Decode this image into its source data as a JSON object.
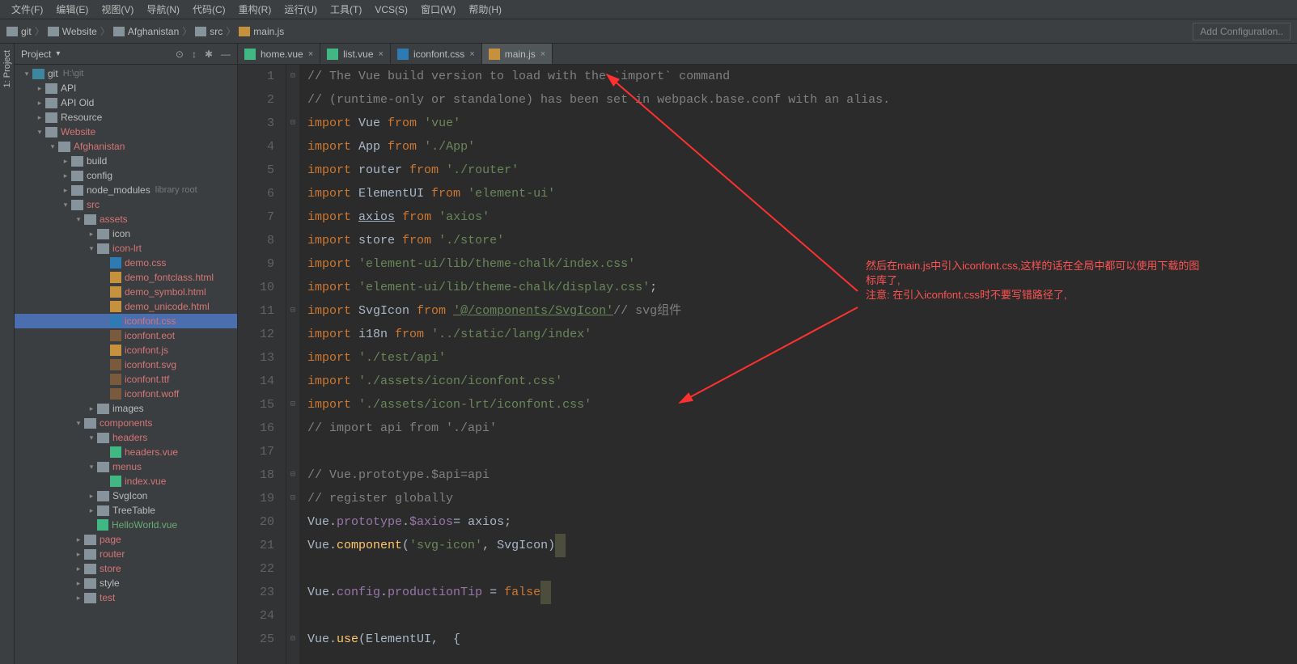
{
  "menu": [
    "文件(F)",
    "编辑(E)",
    "视图(V)",
    "导航(N)",
    "代码(C)",
    "重构(R)",
    "运行(U)",
    "工具(T)",
    "VCS(S)",
    "窗口(W)",
    "帮助(H)"
  ],
  "breadcrumbs": [
    "git",
    "Website",
    "Afghanistan",
    "src",
    "main.js"
  ],
  "configButton": "Add Configuration..",
  "panel": {
    "title": "Project"
  },
  "rootHint": "H:\\git",
  "libHint": "library root",
  "tree": {
    "git": "git",
    "api": "API",
    "apiold": "API Old",
    "resource": "Resource",
    "website": "Website",
    "afghanistan": "Afghanistan",
    "build": "build",
    "config": "config",
    "nodemodules": "node_modules",
    "src": "src",
    "assets": "assets",
    "icon": "icon",
    "iconlrt": "icon-lrt",
    "democss": "demo.css",
    "demofc": "demo_fontclass.html",
    "demosym": "demo_symbol.html",
    "demouni": "demo_unicode.html",
    "iconfontcss": "iconfont.css",
    "iconfonteot": "iconfont.eot",
    "iconfontjs": "iconfont.js",
    "iconfontsvg": "iconfont.svg",
    "iconfontttf": "iconfont.ttf",
    "iconfontwoff": "iconfont.woff",
    "images": "images",
    "components": "components",
    "headers": "headers",
    "headersvue": "headers.vue",
    "menus": "menus",
    "indexvue": "index.vue",
    "svgicon": "SvgIcon",
    "treetable": "TreeTable",
    "helloworld": "HelloWorld.vue",
    "page": "page",
    "router": "router",
    "store": "store",
    "style": "style",
    "test": "test"
  },
  "tabs": [
    {
      "icon": "vue",
      "label": "home.vue"
    },
    {
      "icon": "vue",
      "label": "list.vue"
    },
    {
      "icon": "css",
      "label": "iconfont.css"
    },
    {
      "icon": "js",
      "label": "main.js",
      "active": true
    }
  ],
  "code": [
    {
      "n": 1,
      "t": "comment",
      "text": "// The Vue build version to load with the `import` command"
    },
    {
      "n": 2,
      "t": "comment",
      "text": "// (runtime-only or standalone) has been set in webpack.base.conf with an alias."
    },
    {
      "n": 3,
      "t": "import",
      "ident": "Vue",
      "from": "'vue'"
    },
    {
      "n": 4,
      "t": "import",
      "ident": "App",
      "from": "'./App'"
    },
    {
      "n": 5,
      "t": "import",
      "ident": "router",
      "from": "'./router'"
    },
    {
      "n": 6,
      "t": "import",
      "ident": "ElementUI",
      "from": "'element-ui'"
    },
    {
      "n": 7,
      "t": "import",
      "ident": "axios",
      "from": "'axios'",
      "und": true
    },
    {
      "n": 8,
      "t": "import",
      "ident": "store",
      "from": "'./store'"
    },
    {
      "n": 9,
      "t": "importstr",
      "str": "'element-ui/lib/theme-chalk/index.css'"
    },
    {
      "n": 10,
      "t": "importstr",
      "str": "'element-ui/lib/theme-chalk/display.css'",
      "semi": true
    },
    {
      "n": 11,
      "t": "import",
      "ident": "SvgIcon",
      "from": "'@/components/SvgIcon'",
      "undfrom": true,
      "trail": "// svg组件"
    },
    {
      "n": 12,
      "t": "import",
      "ident": "i18n",
      "from": "'../static/lang/index'"
    },
    {
      "n": 13,
      "t": "importstr",
      "str": "'./test/api'"
    },
    {
      "n": 14,
      "t": "importstr",
      "str": "'./assets/icon/iconfont.css'"
    },
    {
      "n": 15,
      "t": "importstr",
      "str": "'./assets/icon-lrt/iconfont.css'"
    },
    {
      "n": 16,
      "t": "comment",
      "text": "// import api from './api'"
    },
    {
      "n": 17,
      "t": "blank"
    },
    {
      "n": 18,
      "t": "comment",
      "text": "// Vue.prototype.$api=api"
    },
    {
      "n": 19,
      "t": "comment",
      "text": "// register globally"
    },
    {
      "n": 20,
      "t": "raw",
      "html": "Vue.<span class='purple'>prototype</span>.<span class='purple'>$axios</span>= axios;"
    },
    {
      "n": 21,
      "t": "raw",
      "html": "Vue.<span class='fn'>component</span>(<span class='str'>'svg-icon'</span>, SvgIcon)<span class='highlight-box'> </span>"
    },
    {
      "n": 22,
      "t": "blank"
    },
    {
      "n": 23,
      "t": "raw",
      "html": "Vue.<span class='purple'>config</span>.<span class='purple'>productionTip</span> = <span class='kw'>false</span><span class='highlight-box'> </span>"
    },
    {
      "n": 24,
      "t": "blank"
    },
    {
      "n": 25,
      "t": "raw",
      "html": "Vue.<span class='fn'>use</span>(ElementUI,  {"
    }
  ],
  "annotation": {
    "line1": "然后在main.js中引入iconfont.css,这样的话在全局中都可以使用下载的图",
    "line2": "标库了,",
    "line3": "注意: 在引入iconfont.css时不要写错路径了,"
  }
}
